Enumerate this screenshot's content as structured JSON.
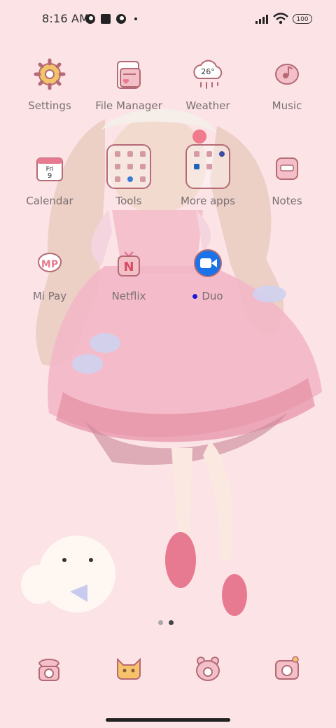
{
  "status_bar": {
    "time": "8:16 AM",
    "battery": "100"
  },
  "apps": [
    {
      "label": "Settings"
    },
    {
      "label": "File Manager"
    },
    {
      "label": "Weather",
      "temp": "26°"
    },
    {
      "label": "Music"
    },
    {
      "label": "Calendar",
      "day_name": "Fri",
      "day_num": "9"
    },
    {
      "label": "Tools"
    },
    {
      "label": "More apps"
    },
    {
      "label": "Notes"
    },
    {
      "label": "Mi Pay",
      "text": "MP"
    },
    {
      "label": "Netflix",
      "text": "N"
    },
    {
      "label": "Duo"
    }
  ],
  "dock": [
    {
      "icon": "phone-icon"
    },
    {
      "icon": "messages-icon"
    },
    {
      "icon": "browser-icon"
    },
    {
      "icon": "camera-icon"
    }
  ],
  "pager": {
    "pages": 2,
    "current": 2
  },
  "colors": {
    "background": "#fbe3e6",
    "icon_stroke": "#b56a74",
    "duo_blue": "#1a73e8",
    "label": "#7a6f72"
  }
}
